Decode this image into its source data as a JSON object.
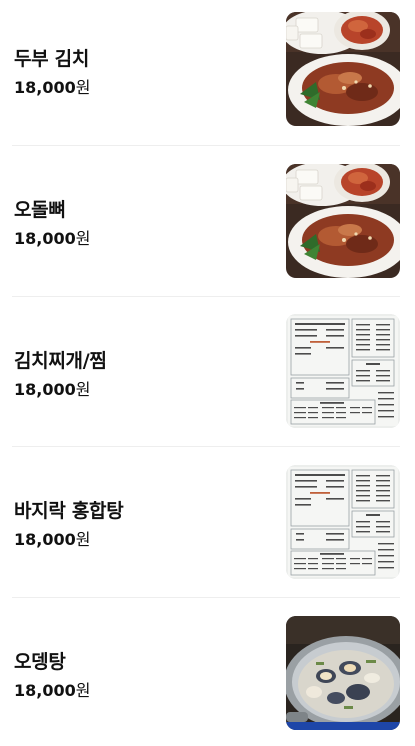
{
  "menu": {
    "items": [
      {
        "name": "두부 김치",
        "price": "18,000",
        "currency": "원",
        "image": "dubu-kimchi-photo"
      },
      {
        "name": "오돌뼈",
        "price": "18,000",
        "currency": "원",
        "image": "dubu-kimchi-photo"
      },
      {
        "name": "김치찌개/찜",
        "price": "18,000",
        "currency": "원",
        "image": "menu-board-photo"
      },
      {
        "name": "바지락 홍합탕",
        "price": "18,000",
        "currency": "원",
        "image": "menu-board-photo"
      },
      {
        "name": "오뎅탕",
        "price": "18,000",
        "currency": "원",
        "image": "odeng-tang-photo"
      }
    ]
  }
}
